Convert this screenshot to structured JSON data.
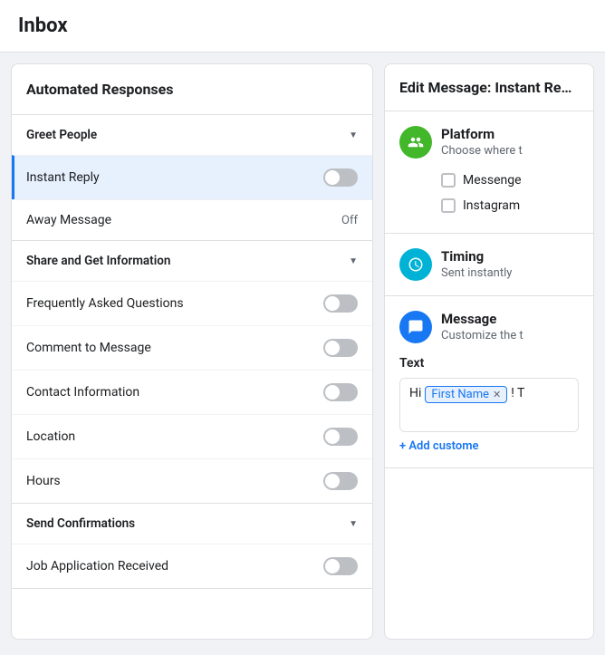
{
  "header": {
    "title": "Inbox"
  },
  "leftPanel": {
    "title": "Automated Responses",
    "sections": [
      {
        "id": "greet-people",
        "label": "Greet People",
        "collapsible": true,
        "items": [
          {
            "id": "instant-reply",
            "label": "Instant Reply",
            "type": "toggle",
            "active": true,
            "value": false
          },
          {
            "id": "away-message",
            "label": "Away Message",
            "type": "text",
            "value": "Off"
          }
        ]
      },
      {
        "id": "share-get-info",
        "label": "Share and Get Information",
        "collapsible": true,
        "items": [
          {
            "id": "faq",
            "label": "Frequently Asked Questions",
            "type": "toggle",
            "value": false
          },
          {
            "id": "comment-to-message",
            "label": "Comment to Message",
            "type": "toggle",
            "value": false
          },
          {
            "id": "contact-information",
            "label": "Contact Information",
            "type": "toggle",
            "value": false
          },
          {
            "id": "location",
            "label": "Location",
            "type": "toggle",
            "value": false
          },
          {
            "id": "hours",
            "label": "Hours",
            "type": "toggle",
            "value": false
          }
        ]
      },
      {
        "id": "send-confirmations",
        "label": "Send Confirmations",
        "collapsible": true,
        "items": [
          {
            "id": "job-application",
            "label": "Job Application Received",
            "type": "toggle",
            "value": false
          }
        ]
      }
    ]
  },
  "rightPanel": {
    "title": "Edit Message: Instant Reply",
    "sections": [
      {
        "id": "platform",
        "icon": "people-icon",
        "iconBg": "platform",
        "title": "Platform",
        "description": "Choose where t",
        "options": [
          {
            "id": "messenger",
            "label": "Messenge"
          },
          {
            "id": "instagram",
            "label": "Instagram"
          }
        ]
      },
      {
        "id": "timing",
        "icon": "clock-icon",
        "iconBg": "timing",
        "title": "Timing",
        "description": "Sent instantly"
      },
      {
        "id": "message",
        "icon": "message-icon",
        "iconBg": "message",
        "title": "Message",
        "description": "Customize the t",
        "textLabel": "Text",
        "textContent": "Hi",
        "textChip": "First Name",
        "textAfter": "! T",
        "addLink": "+ Add custome"
      }
    ]
  }
}
